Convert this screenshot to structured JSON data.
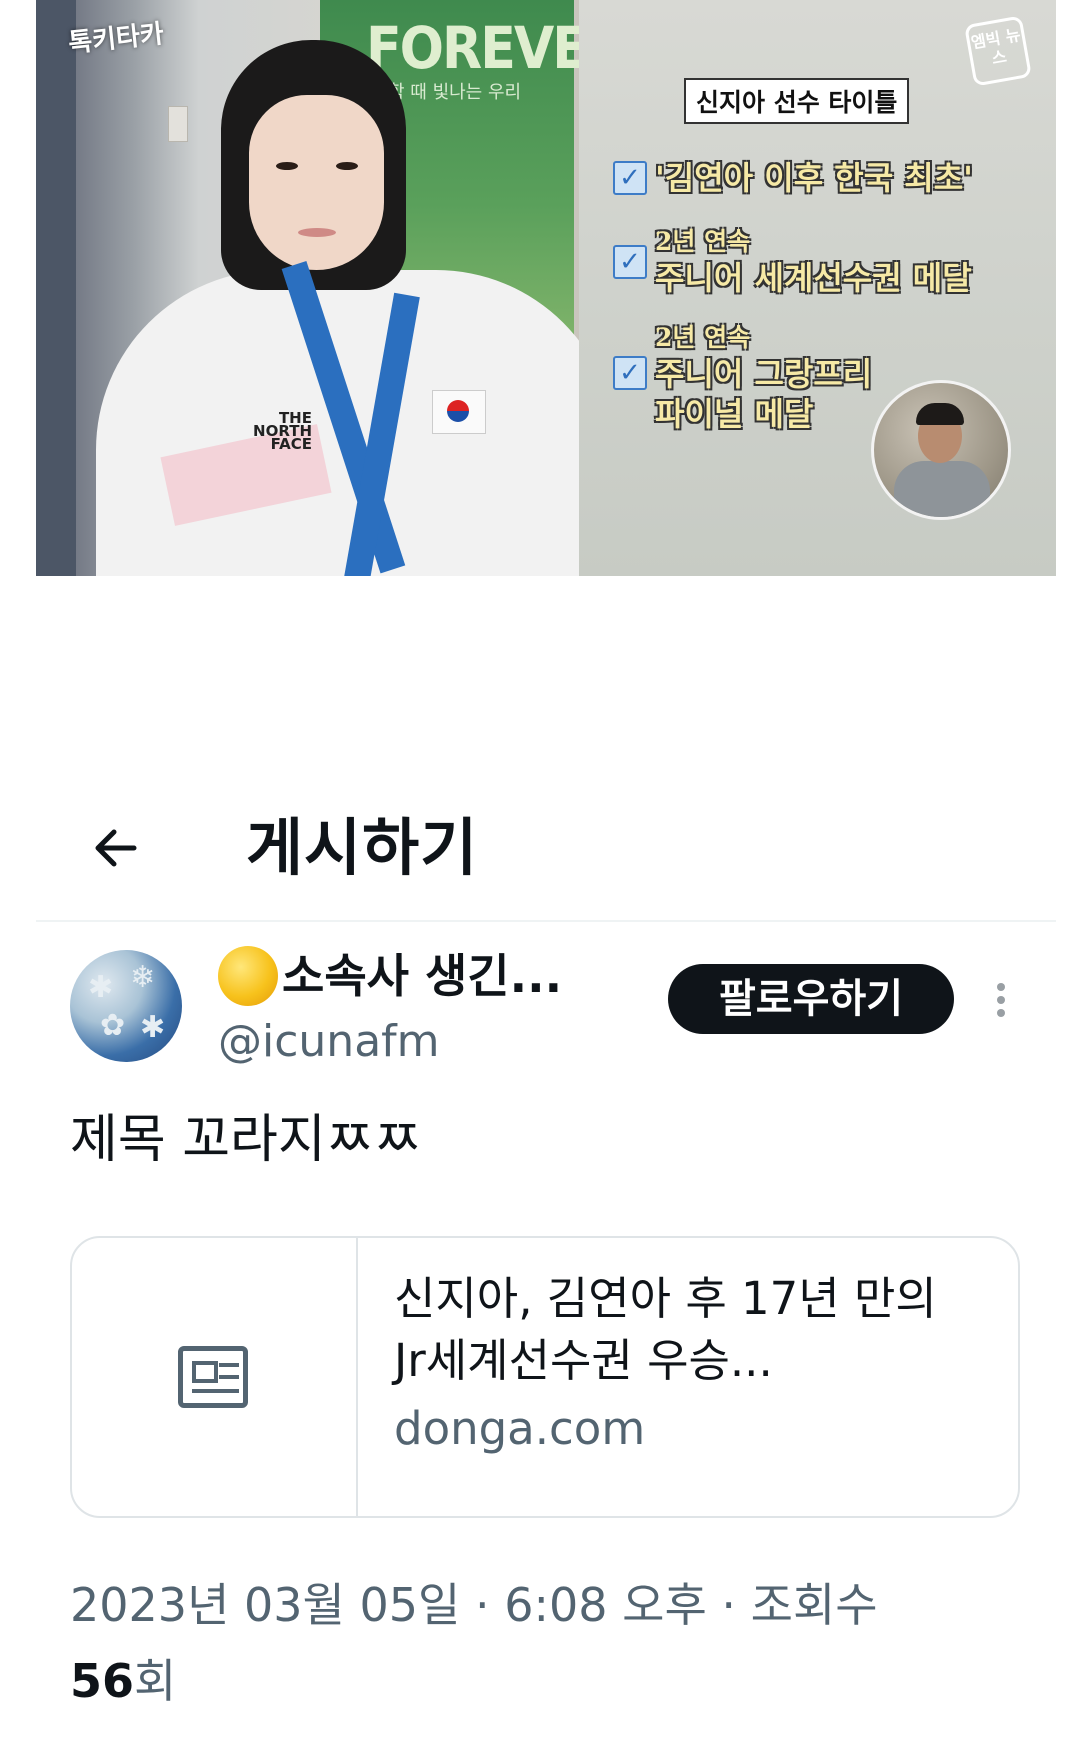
{
  "thumbnail": {
    "logo": "톡키타카",
    "banner_text": "FOREVER",
    "banner_subtext": "함 때 빛나는 우리",
    "jacket_logo": "THE NORTH FACE",
    "news_logo": "엠빅 뉴스",
    "title": "신지아 선수 타이틀",
    "items": [
      {
        "line1": "",
        "line2": "'김연아 이후 한국 최초'"
      },
      {
        "line1": "2년 연속",
        "line2": "주니어 세계선수권 메달"
      },
      {
        "line1": "2년 연속",
        "line2": "주니어 그랑프리 파이널 메달"
      }
    ]
  },
  "header": {
    "title": "게시하기",
    "back_icon": "arrow-left-icon"
  },
  "post": {
    "display_name": "소속사 생긴...",
    "emoji": "sun-emoji",
    "handle": "@icunafm",
    "follow_label": "팔로우하기",
    "text": "제목 꼬라지ㅉㅉ",
    "card": {
      "icon": "news-article-icon",
      "title": "신지아, 김연아 후 17년 만의 Jr세계선수권 우승...",
      "domain": "donga.com"
    },
    "meta": "2023년 03월 05일 · 6:08 오후 · 조회수",
    "views_count": "56",
    "views_unit": "회"
  },
  "colors": {
    "text_primary": "#0f1419",
    "text_secondary": "#536471",
    "border": "#dfe4e7",
    "button_bg": "#0f1419"
  }
}
